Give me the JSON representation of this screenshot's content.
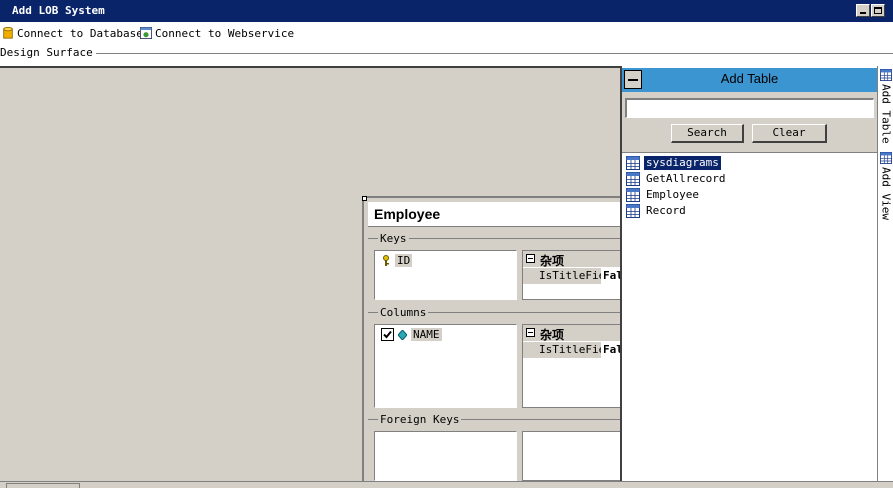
{
  "window": {
    "title": "Add LOB System"
  },
  "toolbar": {
    "connect_db_label": "Connect to Database",
    "connect_ws_label": "Connect to Webservice"
  },
  "section": {
    "label": "Design Surface"
  },
  "entity": {
    "name": "Employee",
    "keys": {
      "legend": "Keys",
      "items": [
        "ID"
      ],
      "category": "杂项",
      "prop_name": "IsTitleField",
      "prop_value": "False"
    },
    "columns": {
      "legend": "Columns",
      "items": [
        {
          "label": "NAME",
          "checked": true
        }
      ],
      "category": "杂项",
      "prop_name": "IsTitleField",
      "prop_value": "False"
    },
    "foreign_keys": {
      "legend": "Foreign Keys"
    }
  },
  "add_table": {
    "title": "Add Table",
    "search_value": "",
    "search_button": "Search",
    "clear_button": "Clear",
    "tables": [
      "sysdiagrams",
      "GetAllrecord",
      "Employee",
      "Record"
    ],
    "selected_index": 0
  },
  "side_tabs": [
    "Add Table",
    "Add View"
  ],
  "icons": {
    "db": "database-icon",
    "ws": "webservice-icon",
    "key": "key-icon",
    "column": "column-icon",
    "table": "table-grid-icon"
  },
  "colors": {
    "titlebar": "#0a246a",
    "panel_header": "#3a95d0",
    "selection": "#0a246a",
    "surface": "#d4d0c8"
  }
}
